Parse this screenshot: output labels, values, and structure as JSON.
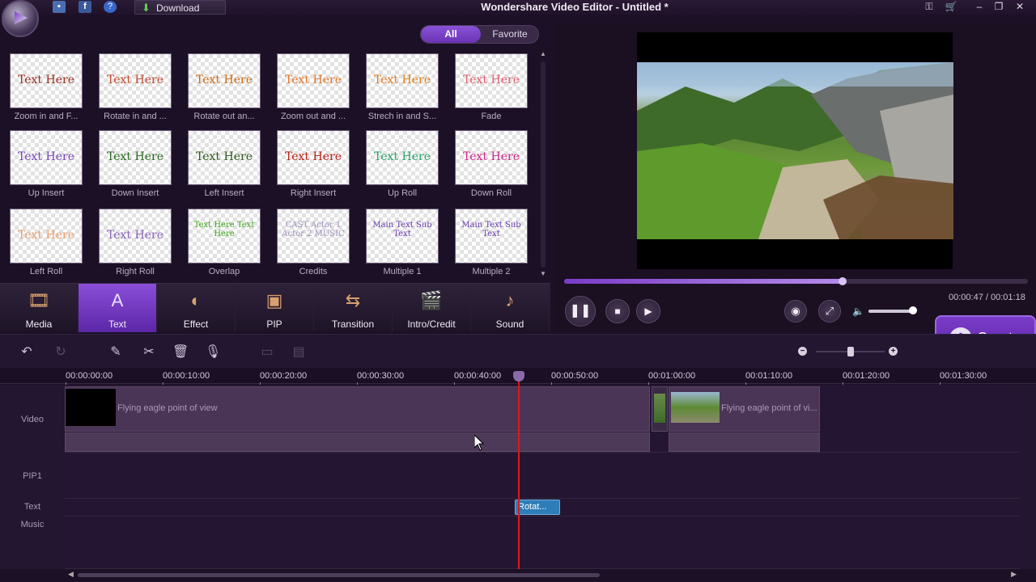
{
  "window": {
    "title": "Wondershare Video Editor - Untitled *"
  },
  "titlebar": {
    "download_label": "Download",
    "fb_glyph": "f",
    "help_glyph": "?"
  },
  "library": {
    "filters": {
      "all": "All",
      "favorite": "Favorite",
      "selected": "All"
    },
    "items": [
      {
        "preview": "Text Here",
        "label": "Zoom in and F...",
        "color": "#9a2e20"
      },
      {
        "preview": "Text Here",
        "label": "Rotate in and ...",
        "color": "#c04a30"
      },
      {
        "preview": "Text Here",
        "label": "Rotate out an...",
        "color": "#d06a10"
      },
      {
        "preview": "Text Here",
        "label": "Zoom out and ...",
        "color": "#e07830"
      },
      {
        "preview": "Text Here",
        "label": "Strech in and S...",
        "color": "#e08020"
      },
      {
        "preview": "Text Here",
        "label": "Fade",
        "color": "#e06070"
      },
      {
        "preview": "Text Here",
        "label": "Up Insert",
        "color": "#7a48b8"
      },
      {
        "preview": "Text Here",
        "label": "Down Insert",
        "color": "#2a6a22"
      },
      {
        "preview": "Text Here",
        "label": "Left Insert",
        "color": "#305a1e"
      },
      {
        "preview": "Text Here",
        "label": "Right Insert",
        "color": "#b82018"
      },
      {
        "preview": "Text Here",
        "label": "Up Roll",
        "color": "#2aa46a"
      },
      {
        "preview": "Text Here",
        "label": "Down Roll",
        "color": "#d02888"
      },
      {
        "preview": "Text Here",
        "label": "Left Roll",
        "color": "#e8a070"
      },
      {
        "preview": "Text Here",
        "label": "Right Roll",
        "color": "#8a64b8"
      },
      {
        "preview": "Text Here Text Here",
        "label": "Overlap",
        "color": "#3aa81a"
      },
      {
        "preview": "CAST Actor 1 Actor 2 MUSIC",
        "label": "Credits",
        "color": "#a090c0"
      },
      {
        "preview": "Main Text Sub Text",
        "label": "Multiple 1",
        "color": "#6a3ab0"
      },
      {
        "preview": "Main Text Sub Text",
        "label": "Multiple 2",
        "color": "#6a3ab0"
      }
    ]
  },
  "tabs": [
    {
      "label": "Media",
      "icon": "film-icon"
    },
    {
      "label": "Text",
      "icon": "text-icon",
      "active": true
    },
    {
      "label": "Effect",
      "icon": "effect-icon"
    },
    {
      "label": "PIP",
      "icon": "pip-icon"
    },
    {
      "label": "Transition",
      "icon": "transition-icon"
    },
    {
      "label": "Intro/Credit",
      "icon": "clapper-icon"
    },
    {
      "label": "Sound",
      "icon": "sound-icon"
    }
  ],
  "preview": {
    "time_display": "00:00:47 / 00:01:18",
    "progress": 0.6,
    "volume": 0.95
  },
  "create_label": "Create",
  "ruler": [
    "00:00:00:00",
    "00:00:10:00",
    "00:00:20:00",
    "00:00:30:00",
    "00:00:40:00",
    "00:00:50:00",
    "00:01:00:00",
    "00:01:10:00",
    "00:01:20:00",
    "00:01:30:00"
  ],
  "tracks": {
    "video": "Video",
    "pip": "PIP1",
    "text": "Text",
    "music": "Music"
  },
  "clips": {
    "video1": "Flying eagle point of view",
    "video2": "Flying eagle point of vi...",
    "text1": "Rotat..."
  },
  "colors": {
    "accent": "#7b3cc8",
    "playhead": "#e01818",
    "text_clip": "#2f7db8"
  }
}
